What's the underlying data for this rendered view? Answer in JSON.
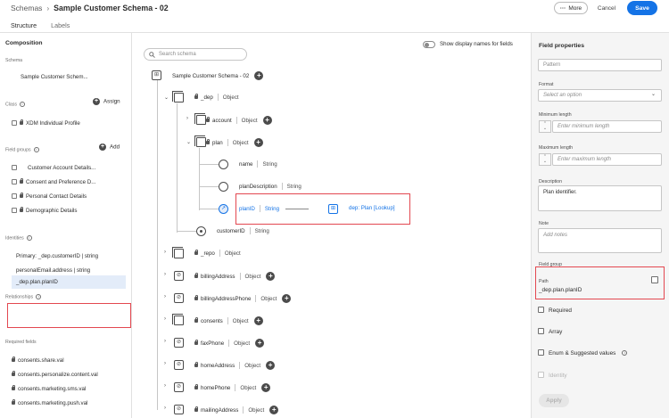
{
  "breadcrumb": {
    "parent": "Schemas",
    "current": "Sample Customer Schema - 02"
  },
  "tabs": [
    "Structure",
    "Labels"
  ],
  "header_buttons": {
    "more": "More",
    "cancel": "Cancel",
    "save": "Save"
  },
  "left": {
    "composition": "Composition",
    "schema_label": "Schema",
    "schema_value": "Sample Customer Schem...",
    "class_label": "Class",
    "assign": "Assign",
    "class_value": "XDM Individual Profile",
    "field_groups_label": "Field groups",
    "add": "Add",
    "field_groups": [
      "Customer Account Details...",
      "Consent and Preference D...",
      "Personal Contact Details",
      "Demographic Details"
    ],
    "identities_label": "Identities",
    "identities": [
      "Primary: _dep.customerID | string",
      "personalEmail.address | string"
    ],
    "relationships_label": "Relationships",
    "relationship": "_dep.plan.planID",
    "required_label": "Required fields",
    "required": [
      "consents.share.val",
      "consents.personalize.content.val",
      "consents.marketing.sms.val",
      "consents.marketing.push.val"
    ]
  },
  "center": {
    "search_placeholder": "Search schema",
    "toggle_label": "Show display names for fields",
    "root": "Sample Customer Schema - 02",
    "nodes": [
      {
        "name": "_dep",
        "type": "Object"
      },
      {
        "name": "account",
        "type": "Object"
      },
      {
        "name": "plan",
        "type": "Object"
      },
      {
        "name": "name",
        "type": "String"
      },
      {
        "name": "planDescription",
        "type": "String"
      },
      {
        "name": "planID",
        "type": "String"
      },
      {
        "name": "customerID",
        "type": "String"
      },
      {
        "name": "_repo",
        "type": "Object"
      },
      {
        "name": "billingAddress",
        "type": "Object"
      },
      {
        "name": "billingAddressPhone",
        "type": "Object"
      },
      {
        "name": "consents",
        "type": "Object"
      },
      {
        "name": "faxPhone",
        "type": "Object"
      },
      {
        "name": "homeAddress",
        "type": "Object"
      },
      {
        "name": "homePhone",
        "type": "Object"
      },
      {
        "name": "mailingAddress",
        "type": "Object"
      }
    ],
    "lookup": "dep: Plan [Lookup]"
  },
  "right": {
    "title": "Field properties",
    "pattern_placeholder": "Pattern",
    "format_label": "Format",
    "format_placeholder": "Select an option",
    "min_label": "Minimum length",
    "min_placeholder": "Enter minimum length",
    "max_label": "Maximum length",
    "max_placeholder": "Enter maximum length",
    "description_label": "Description",
    "description_value": "Plan identifier.",
    "note_label": "Note",
    "note_placeholder": "Add notes",
    "field_group_label": "Field group",
    "path_label": "Path",
    "path_value": "_dep.plan.planID",
    "required": "Required",
    "array": "Array",
    "enum": "Enum & Suggested values",
    "identity": "Identity",
    "apply": "Apply"
  }
}
